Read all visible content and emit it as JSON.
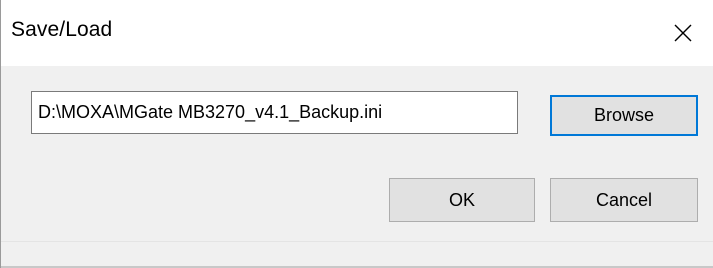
{
  "window": {
    "title": "Save/Load",
    "close_icon": "close-icon"
  },
  "file": {
    "path_value": "D:\\MOXA\\MGate MB3270_v4.1_Backup.ini"
  },
  "buttons": {
    "browse_label": "Browse",
    "ok_label": "OK",
    "cancel_label": "Cancel"
  },
  "colors": {
    "accent": "#0078d7",
    "button_face": "#e1e1e1",
    "dialog_background": "#f0f0f0"
  }
}
